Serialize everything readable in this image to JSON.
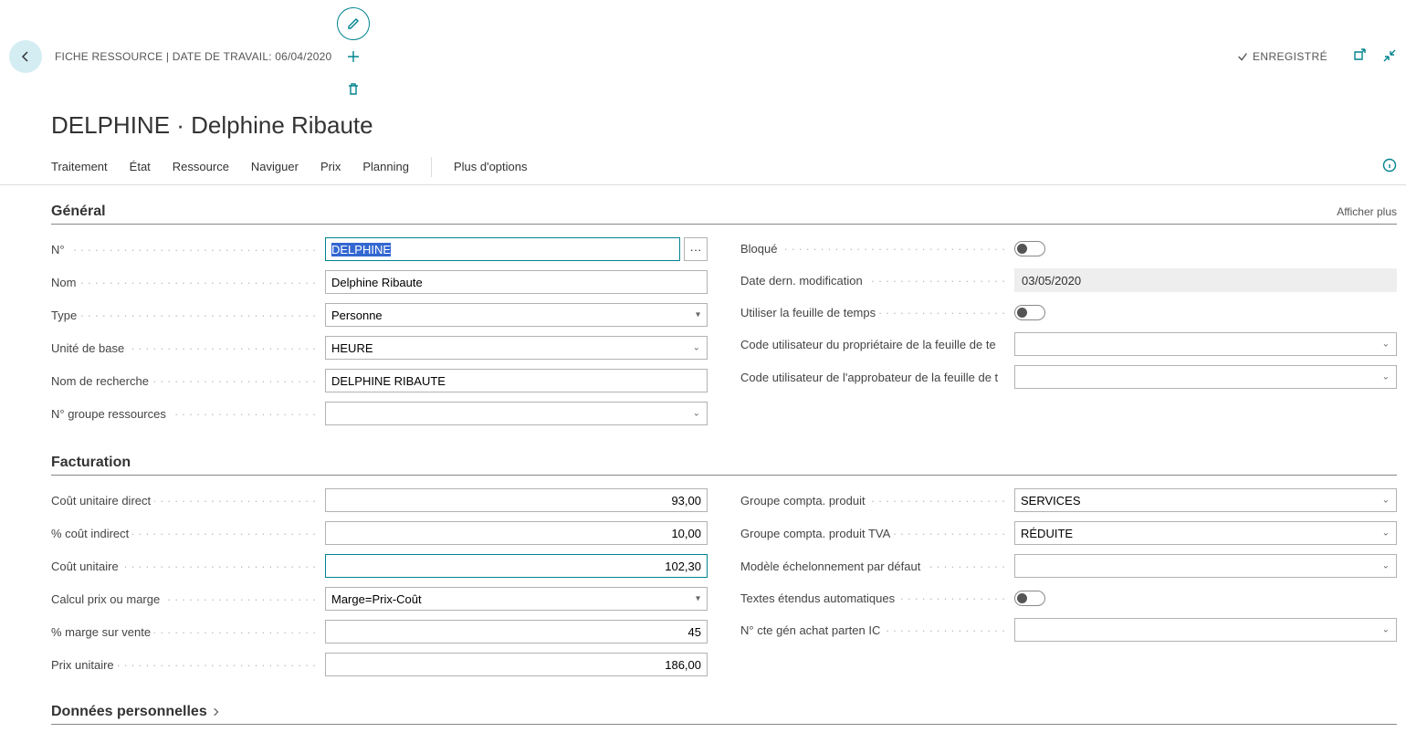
{
  "header": {
    "breadcrumb": "FICHE RESSOURCE | DATE DE TRAVAIL: 06/04/2020",
    "page_title": "DELPHINE · Delphine Ribaute",
    "saved_label": "ENREGISTRÉ"
  },
  "toolbar": {
    "items": [
      "Traitement",
      "État",
      "Ressource",
      "Naviguer",
      "Prix",
      "Planning"
    ],
    "more_options": "Plus d'options"
  },
  "sections": {
    "general": {
      "title": "Général",
      "show_more": "Afficher plus",
      "left": {
        "no_label": "N°",
        "no_value": "DELPHINE",
        "nom_label": "Nom",
        "nom_value": "Delphine Ribaute",
        "type_label": "Type",
        "type_value": "Personne",
        "unite_label": "Unité de base",
        "unite_value": "HEURE",
        "recherche_label": "Nom de recherche",
        "recherche_value": "DELPHINE RIBAUTE",
        "groupe_label": "N° groupe ressources",
        "groupe_value": ""
      },
      "right": {
        "bloque_label": "Bloqué",
        "date_mod_label": "Date dern. modification",
        "date_mod_value": "03/05/2020",
        "feuille_label": "Utiliser la feuille de temps",
        "prop_label": "Code utilisateur du propriétaire de la feuille de tem...",
        "prop_value": "",
        "approb_label": "Code utilisateur de l'approbateur de la feuille de te...",
        "approb_value": ""
      }
    },
    "facturation": {
      "title": "Facturation",
      "left": {
        "cout_direct_label": "Coût unitaire direct",
        "cout_direct_value": "93,00",
        "pct_indirect_label": "% coût indirect",
        "pct_indirect_value": "10,00",
        "cout_unitaire_label": "Coût unitaire",
        "cout_unitaire_value": "102,30",
        "calcul_label": "Calcul prix ou marge",
        "calcul_value": "Marge=Prix-Coût",
        "pct_marge_label": "% marge sur vente",
        "pct_marge_value": "45",
        "prix_unitaire_label": "Prix unitaire",
        "prix_unitaire_value": "186,00"
      },
      "right": {
        "gcp_label": "Groupe compta. produit",
        "gcp_value": "SERVICES",
        "gcptva_label": "Groupe compta. produit TVA",
        "gcptva_value": "RÉDUITE",
        "modele_label": "Modèle échelonnement par défaut",
        "modele_value": "",
        "textes_label": "Textes étendus automatiques",
        "ic_label": "N° cte gén achat parten IC",
        "ic_value": ""
      }
    },
    "donnees_perso": {
      "title": "Données personnelles"
    }
  }
}
